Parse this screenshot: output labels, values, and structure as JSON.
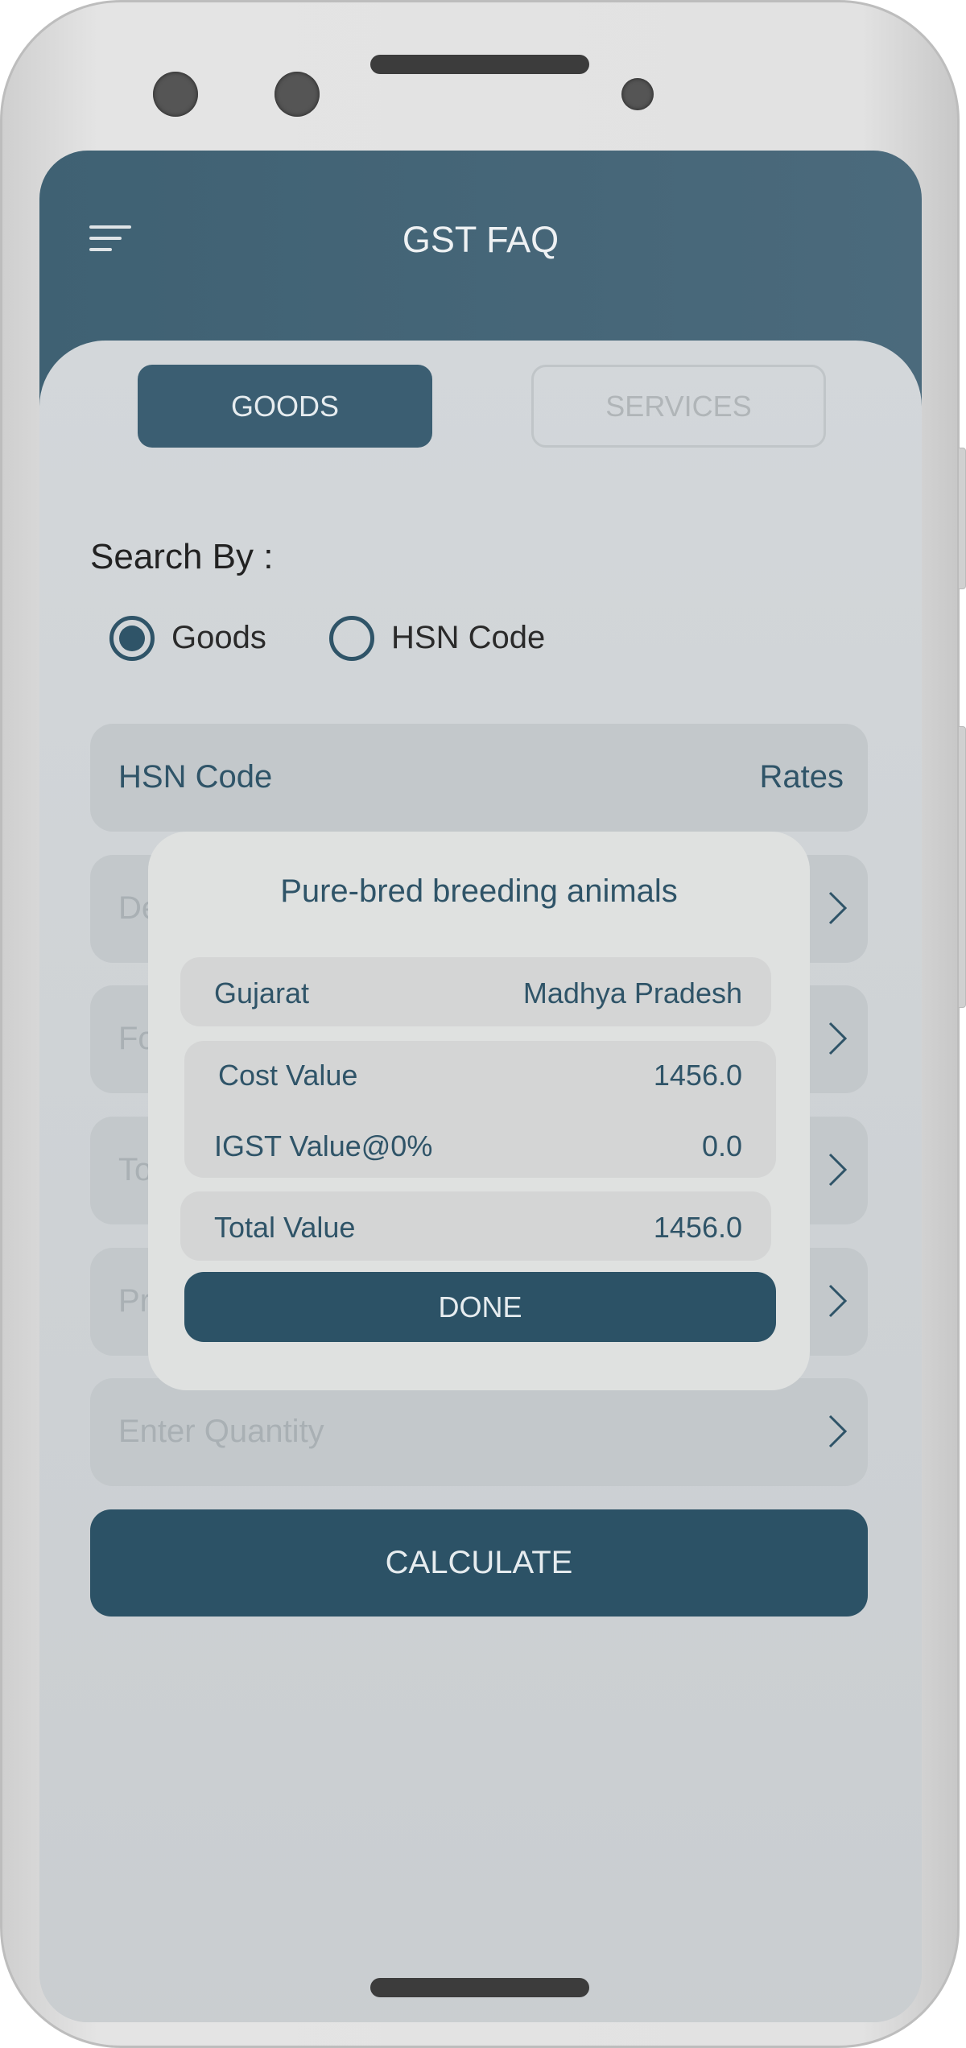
{
  "app": {
    "title": "GST FAQ",
    "menu_icon": "hamburger-menu-icon"
  },
  "tabs": [
    {
      "label": "GOODS",
      "active": true
    },
    {
      "label": "SERVICES",
      "active": false
    }
  ],
  "search": {
    "label": "Search By :",
    "options": [
      {
        "label": "Goods",
        "selected": true
      },
      {
        "label": "HSN Code",
        "selected": false
      }
    ]
  },
  "table_header": {
    "left": "HSN Code",
    "right": "Rates"
  },
  "fields": [
    {
      "placeholder": "De"
    },
    {
      "placeholder": "Fo"
    },
    {
      "placeholder": "To"
    },
    {
      "placeholder": "Pr"
    },
    {
      "placeholder": "Enter Quantity"
    }
  ],
  "calculate_label": "CALCULATE",
  "modal": {
    "title": "Pure-bred breeding animals",
    "from_state": "Gujarat",
    "to_state": "Madhya Pradesh",
    "cost_label": "Cost Value",
    "cost_value": "1456.0",
    "igst_label": "IGST Value@0%",
    "igst_value": "0.0",
    "total_label": "Total Value",
    "total_value": "1456.0",
    "done_label": "DONE"
  },
  "colors": {
    "primary": "#2c5266",
    "header": "#46667a",
    "text": "#2f5468"
  }
}
